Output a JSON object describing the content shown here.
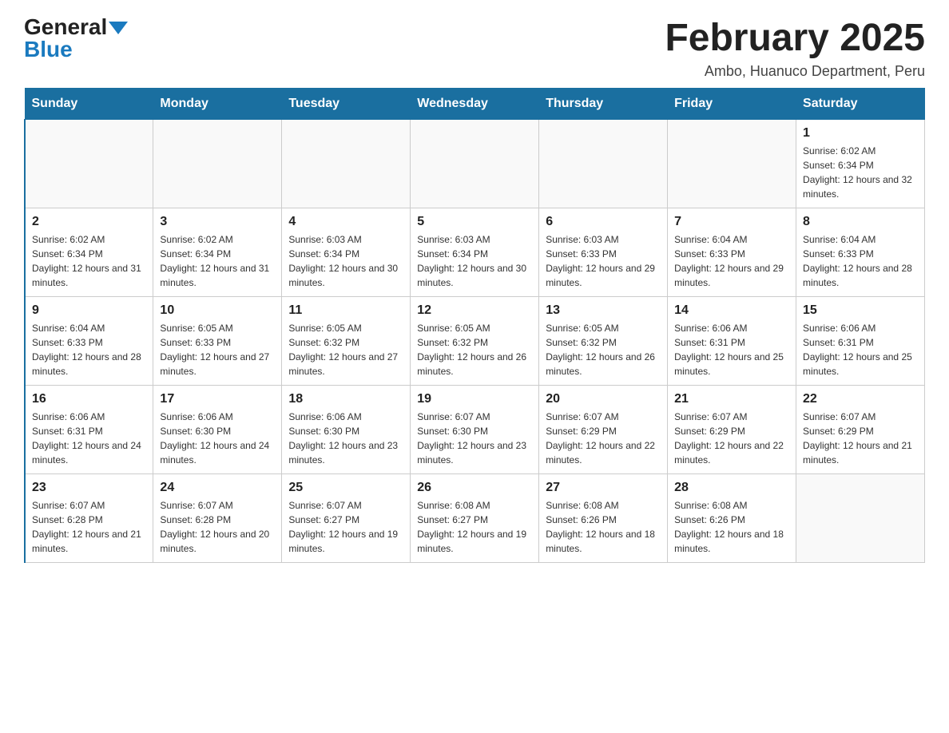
{
  "logo": {
    "general": "General",
    "blue": "Blue",
    "triangle": "▶"
  },
  "title": "February 2025",
  "subtitle": "Ambo, Huanuco Department, Peru",
  "days_of_week": [
    "Sunday",
    "Monday",
    "Tuesday",
    "Wednesday",
    "Thursday",
    "Friday",
    "Saturday"
  ],
  "weeks": [
    [
      {
        "day": "",
        "info": ""
      },
      {
        "day": "",
        "info": ""
      },
      {
        "day": "",
        "info": ""
      },
      {
        "day": "",
        "info": ""
      },
      {
        "day": "",
        "info": ""
      },
      {
        "day": "",
        "info": ""
      },
      {
        "day": "1",
        "info": "Sunrise: 6:02 AM\nSunset: 6:34 PM\nDaylight: 12 hours and 32 minutes."
      }
    ],
    [
      {
        "day": "2",
        "info": "Sunrise: 6:02 AM\nSunset: 6:34 PM\nDaylight: 12 hours and 31 minutes."
      },
      {
        "day": "3",
        "info": "Sunrise: 6:02 AM\nSunset: 6:34 PM\nDaylight: 12 hours and 31 minutes."
      },
      {
        "day": "4",
        "info": "Sunrise: 6:03 AM\nSunset: 6:34 PM\nDaylight: 12 hours and 30 minutes."
      },
      {
        "day": "5",
        "info": "Sunrise: 6:03 AM\nSunset: 6:34 PM\nDaylight: 12 hours and 30 minutes."
      },
      {
        "day": "6",
        "info": "Sunrise: 6:03 AM\nSunset: 6:33 PM\nDaylight: 12 hours and 29 minutes."
      },
      {
        "day": "7",
        "info": "Sunrise: 6:04 AM\nSunset: 6:33 PM\nDaylight: 12 hours and 29 minutes."
      },
      {
        "day": "8",
        "info": "Sunrise: 6:04 AM\nSunset: 6:33 PM\nDaylight: 12 hours and 28 minutes."
      }
    ],
    [
      {
        "day": "9",
        "info": "Sunrise: 6:04 AM\nSunset: 6:33 PM\nDaylight: 12 hours and 28 minutes."
      },
      {
        "day": "10",
        "info": "Sunrise: 6:05 AM\nSunset: 6:33 PM\nDaylight: 12 hours and 27 minutes."
      },
      {
        "day": "11",
        "info": "Sunrise: 6:05 AM\nSunset: 6:32 PM\nDaylight: 12 hours and 27 minutes."
      },
      {
        "day": "12",
        "info": "Sunrise: 6:05 AM\nSunset: 6:32 PM\nDaylight: 12 hours and 26 minutes."
      },
      {
        "day": "13",
        "info": "Sunrise: 6:05 AM\nSunset: 6:32 PM\nDaylight: 12 hours and 26 minutes."
      },
      {
        "day": "14",
        "info": "Sunrise: 6:06 AM\nSunset: 6:31 PM\nDaylight: 12 hours and 25 minutes."
      },
      {
        "day": "15",
        "info": "Sunrise: 6:06 AM\nSunset: 6:31 PM\nDaylight: 12 hours and 25 minutes."
      }
    ],
    [
      {
        "day": "16",
        "info": "Sunrise: 6:06 AM\nSunset: 6:31 PM\nDaylight: 12 hours and 24 minutes."
      },
      {
        "day": "17",
        "info": "Sunrise: 6:06 AM\nSunset: 6:30 PM\nDaylight: 12 hours and 24 minutes."
      },
      {
        "day": "18",
        "info": "Sunrise: 6:06 AM\nSunset: 6:30 PM\nDaylight: 12 hours and 23 minutes."
      },
      {
        "day": "19",
        "info": "Sunrise: 6:07 AM\nSunset: 6:30 PM\nDaylight: 12 hours and 23 minutes."
      },
      {
        "day": "20",
        "info": "Sunrise: 6:07 AM\nSunset: 6:29 PM\nDaylight: 12 hours and 22 minutes."
      },
      {
        "day": "21",
        "info": "Sunrise: 6:07 AM\nSunset: 6:29 PM\nDaylight: 12 hours and 22 minutes."
      },
      {
        "day": "22",
        "info": "Sunrise: 6:07 AM\nSunset: 6:29 PM\nDaylight: 12 hours and 21 minutes."
      }
    ],
    [
      {
        "day": "23",
        "info": "Sunrise: 6:07 AM\nSunset: 6:28 PM\nDaylight: 12 hours and 21 minutes."
      },
      {
        "day": "24",
        "info": "Sunrise: 6:07 AM\nSunset: 6:28 PM\nDaylight: 12 hours and 20 minutes."
      },
      {
        "day": "25",
        "info": "Sunrise: 6:07 AM\nSunset: 6:27 PM\nDaylight: 12 hours and 19 minutes."
      },
      {
        "day": "26",
        "info": "Sunrise: 6:08 AM\nSunset: 6:27 PM\nDaylight: 12 hours and 19 minutes."
      },
      {
        "day": "27",
        "info": "Sunrise: 6:08 AM\nSunset: 6:26 PM\nDaylight: 12 hours and 18 minutes."
      },
      {
        "day": "28",
        "info": "Sunrise: 6:08 AM\nSunset: 6:26 PM\nDaylight: 12 hours and 18 minutes."
      },
      {
        "day": "",
        "info": ""
      }
    ]
  ]
}
